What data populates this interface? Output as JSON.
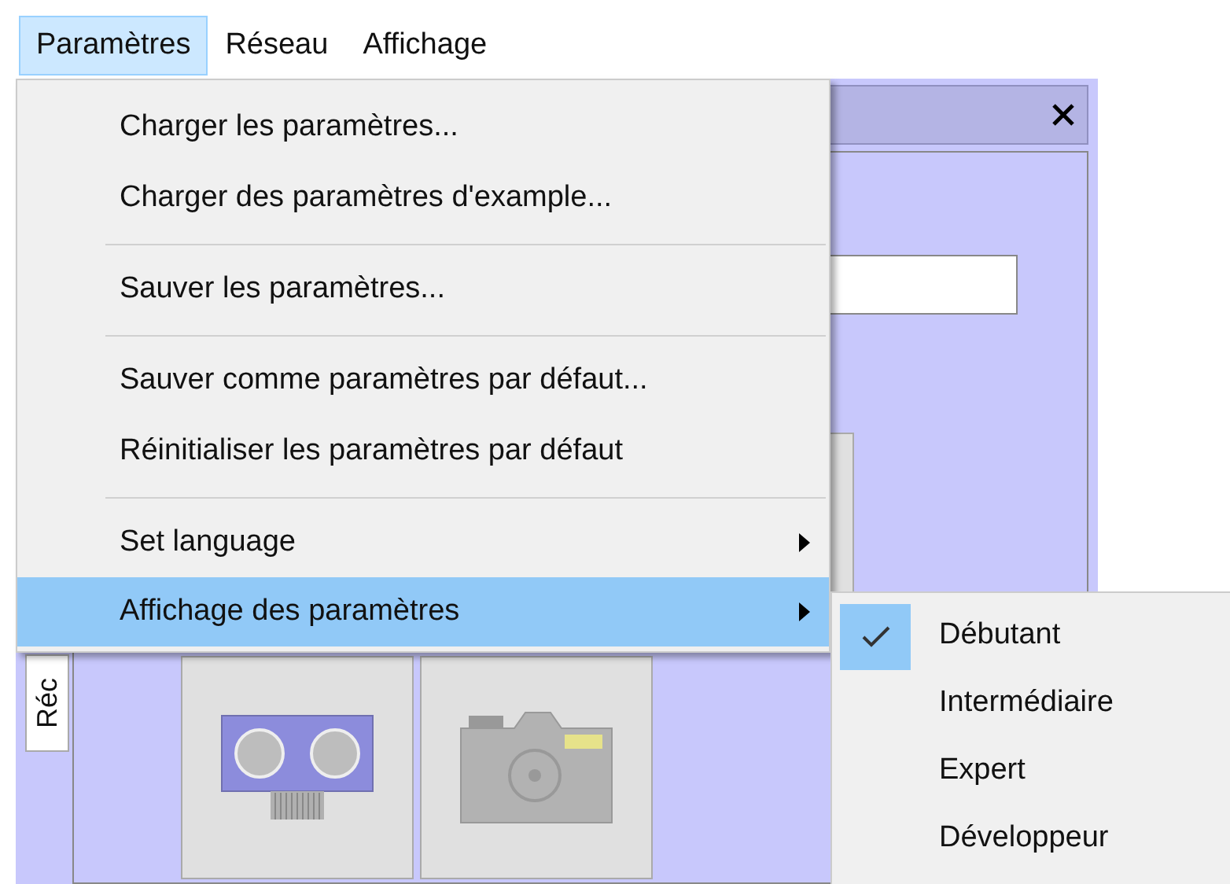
{
  "menubar": [
    {
      "label": "Paramètres",
      "selected": true
    },
    {
      "label": "Réseau",
      "selected": false
    },
    {
      "label": "Affichage",
      "selected": false
    }
  ],
  "panel": {
    "side_tab": "Réc"
  },
  "menu": [
    {
      "kind": "item",
      "label": "Charger les paramètres..."
    },
    {
      "kind": "item",
      "label": "Charger des paramètres d'example..."
    },
    {
      "kind": "separator"
    },
    {
      "kind": "item",
      "label": "Sauver les paramètres..."
    },
    {
      "kind": "separator"
    },
    {
      "kind": "item",
      "label": "Sauver comme paramètres par défaut..."
    },
    {
      "kind": "item",
      "label": "Réinitialiser les paramètres par défaut"
    },
    {
      "kind": "separator"
    },
    {
      "kind": "submenu",
      "label": "Set language",
      "selected": false
    },
    {
      "kind": "submenu",
      "label": "Affichage des paramètres",
      "selected": true
    }
  ],
  "submenu": [
    {
      "label": "Débutant",
      "checked": true
    },
    {
      "label": "Intermédiaire",
      "checked": false
    },
    {
      "label": "Expert",
      "checked": false
    },
    {
      "label": "Développeur",
      "checked": false
    }
  ]
}
